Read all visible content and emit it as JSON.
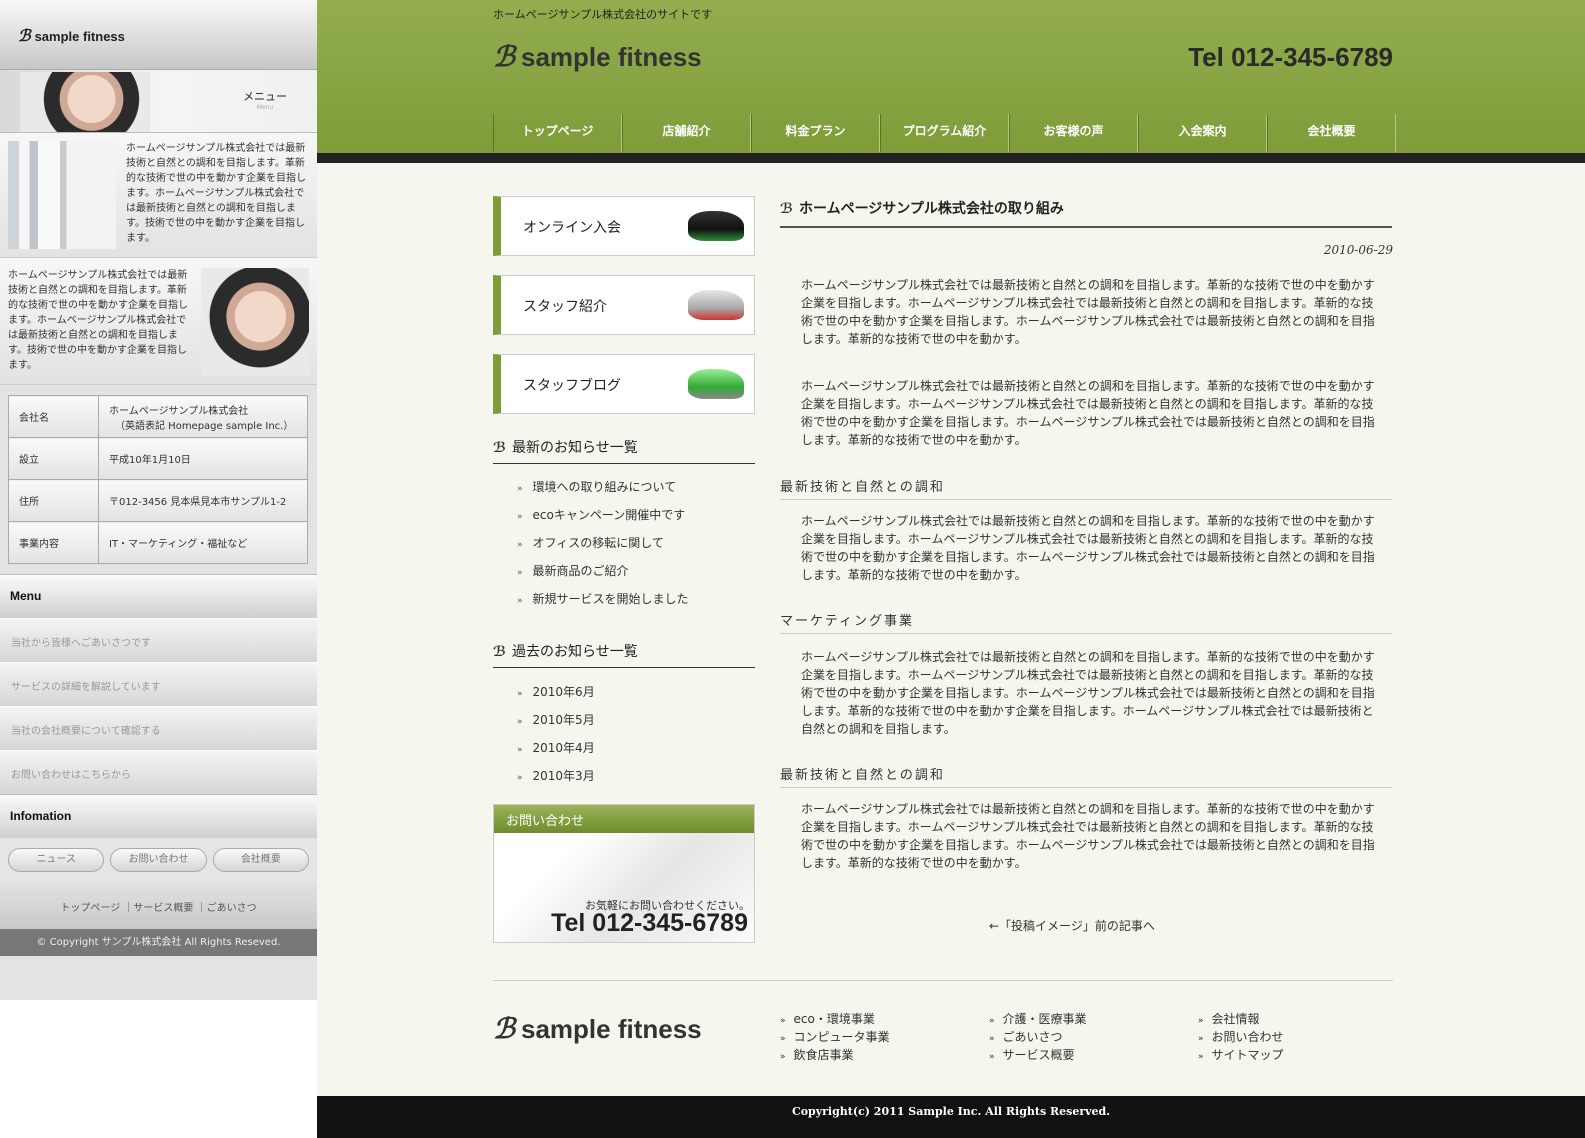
{
  "sidebar": {
    "brand": "sample fitness",
    "menu_label": "メニュー",
    "menu_sub": "Menu",
    "box1": "ホームページサンプル株式会社では最新技術と自然との調和を目指します。革新的な技術で世の中を動かす企業を目指します。ホームページサンプル株式会社では最新技術と自然との調和を目指します。技術で世の中を動かす企業を目指します。",
    "box2": "ホームページサンプル株式会社では最新技術と自然との調和を目指します。革新的な技術で世の中を動かす企業を目指します。ホームページサンプル株式会社では最新技術と自然との調和を目指します。技術で世の中を動かす企業を目指します。",
    "company": [
      {
        "k": "会社名",
        "v": "ホームページサンプル株式会社",
        "v2": "（英語表記 Homepage sample Inc.）"
      },
      {
        "k": "設立",
        "v": "平成10年1月10日"
      },
      {
        "k": "住所",
        "v": "〒012-3456 見本県見本市サンプル1-2"
      },
      {
        "k": "事業内容",
        "v": "IT・マーケティング・福祉など"
      }
    ],
    "menu_title": "Menu",
    "menu": [
      "当社から皆様へごあいさつです",
      "サービスの詳細を解説しています",
      "当社の会社概要について確認する",
      "お問い合わせはこちらから"
    ],
    "info_title": "Infomation",
    "pills": [
      "ニュース",
      "お問い合わせ",
      "会社概要"
    ],
    "links": "トップページ ｜サービス概要 ｜ごあいさつ",
    "copyright": "© Copyright サンプル株式会社 All Rights Reseved."
  },
  "header": {
    "tagline": "ホームページサンプル株式会社のサイトです",
    "brand": "sample fitness",
    "tel": "Tel 012-345-6789",
    "nav": [
      "トップページ",
      "店舗紹介",
      "料金プラン",
      "プログラム紹介",
      "お客様の声",
      "入会案内",
      "会社概要"
    ]
  },
  "banners": [
    "オンライン入会",
    "スタッフ紹介",
    "スタッフブログ"
  ],
  "news": {
    "title": "最新のお知らせ一覧",
    "items": [
      "環境への取り組みについて",
      "ecoキャンペーン開催中です",
      "オフィスの移転に関して",
      "最新商品のご紹介",
      "新規サービスを開始しました"
    ]
  },
  "past": {
    "title": "過去のお知らせ一覧",
    "items": [
      "2010年6月",
      "2010年5月",
      "2010年4月",
      "2010年3月"
    ]
  },
  "contact": {
    "title": "お問い合わせ",
    "text": "お気軽にお問い合わせください。",
    "tel": "Tel 012-345-6789"
  },
  "article": {
    "title": "ホームページサンプル株式会社の取り組み",
    "date": "2010-06-29",
    "p1": "ホームページサンプル株式会社では最新技術と自然との調和を目指します。革新的な技術で世の中を動かす企業を目指します。ホームページサンプル株式会社では最新技術と自然との調和を目指します。革新的な技術で世の中を動かす企業を目指します。ホームページサンプル株式会社では最新技術と自然との調和を目指します。革新的な技術で世の中を動かす。",
    "p2": "ホームページサンプル株式会社では最新技術と自然との調和を目指します。革新的な技術で世の中を動かす企業を目指します。ホームページサンプル株式会社では最新技術と自然との調和を目指します。革新的な技術で世の中を動かす企業を目指します。ホームページサンプル株式会社では最新技術と自然との調和を目指します。革新的な技術で世の中を動かす。",
    "h1": "最新技術と自然との調和",
    "p3": "ホームページサンプル株式会社では最新技術と自然との調和を目指します。革新的な技術で世の中を動かす企業を目指します。ホームページサンプル株式会社では最新技術と自然との調和を目指します。革新的な技術で世の中を動かす企業を目指します。ホームページサンプル株式会社では最新技術と自然との調和を目指します。革新的な技術で世の中を動かす。",
    "h2": "マーケティング事業",
    "p4": "ホームページサンプル株式会社では最新技術と自然との調和を目指します。革新的な技術で世の中を動かす企業を目指します。ホームページサンプル株式会社では最新技術と自然との調和を目指します。革新的な技術で世の中を動かす企業を目指します。ホームページサンプル株式会社では最新技術と自然との調和を目指します。革新的な技術で世の中を動かす企業を目指します。ホームページサンプル株式会社では最新技術と自然との調和を目指します。",
    "h3": "最新技術と自然との調和",
    "p5": "ホームページサンプル株式会社では最新技術と自然との調和を目指します。革新的な技術で世の中を動かす企業を目指します。ホームページサンプル株式会社では最新技術と自然との調和を目指します。革新的な技術で世の中を動かす企業を目指します。ホームページサンプル株式会社では最新技術と自然との調和を目指します。革新的な技術で世の中を動かす。",
    "prev": "←「投稿イメージ」前の記事へ"
  },
  "footer": {
    "brand": "sample fitness",
    "col1": [
      "eco・環境事業",
      "コンピュータ事業",
      "飲食店事業"
    ],
    "col2": [
      "介護・医療事業",
      "ごあいさつ",
      "サービス概要"
    ],
    "col3": [
      "会社情報",
      "お問い合わせ",
      "サイトマップ"
    ],
    "copyright": "Copyright(c) 2011 Sample Inc. All Rights Reserved."
  },
  "colors": {
    "green": "#7f9c39",
    "dark": "#222222"
  }
}
